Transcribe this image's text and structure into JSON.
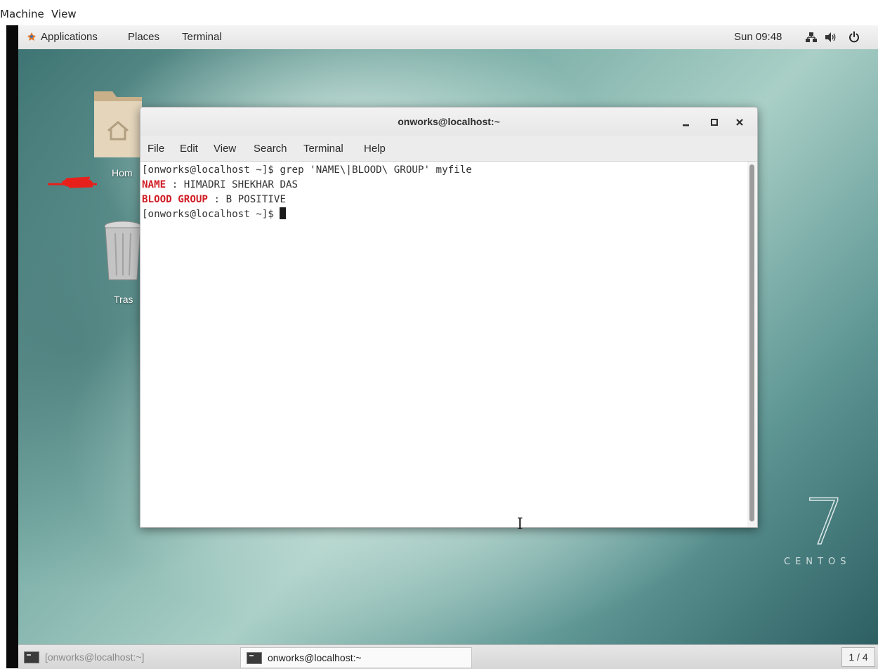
{
  "vm_menu": {
    "items": [
      "Machine",
      "View"
    ]
  },
  "top_panel": {
    "applications": "Applications",
    "places": "Places",
    "terminal": "Terminal",
    "clock": "Sun 09:48",
    "icons": [
      "network-icon",
      "volume-icon",
      "power-icon"
    ]
  },
  "desktop": {
    "icons": [
      {
        "label": "Hom",
        "icon": "home-folder-icon"
      },
      {
        "label": "Tras",
        "icon": "trash-icon"
      }
    ],
    "branding": {
      "number": "7",
      "name": "CENTOS"
    }
  },
  "terminal_window": {
    "title": "onworks@localhost:~",
    "controls": [
      "minimize-icon",
      "maximize-icon",
      "close-icon"
    ],
    "menu": [
      "File",
      "Edit",
      "View",
      "Search",
      "Terminal",
      "Help"
    ],
    "lines": [
      {
        "text": "[onworks@localhost ~]$ grep 'NAME\\|BLOOD\\ GROUP' myfile"
      },
      {
        "match": "NAME",
        "rest": " : HIMADRI SHEKHAR DAS"
      },
      {
        "match": "BLOOD GROUP",
        "rest": " : B POSITIVE"
      },
      {
        "text": "[onworks@localhost ~]$ "
      }
    ]
  },
  "taskbar": {
    "items": [
      {
        "label": "[onworks@localhost:~]",
        "active": false
      },
      {
        "label": "onworks@localhost:~",
        "active": true
      }
    ],
    "workspace": "1 / 4"
  },
  "colors": {
    "match_highlight": "#d01c24",
    "annotation_mark": "#e8201c"
  }
}
